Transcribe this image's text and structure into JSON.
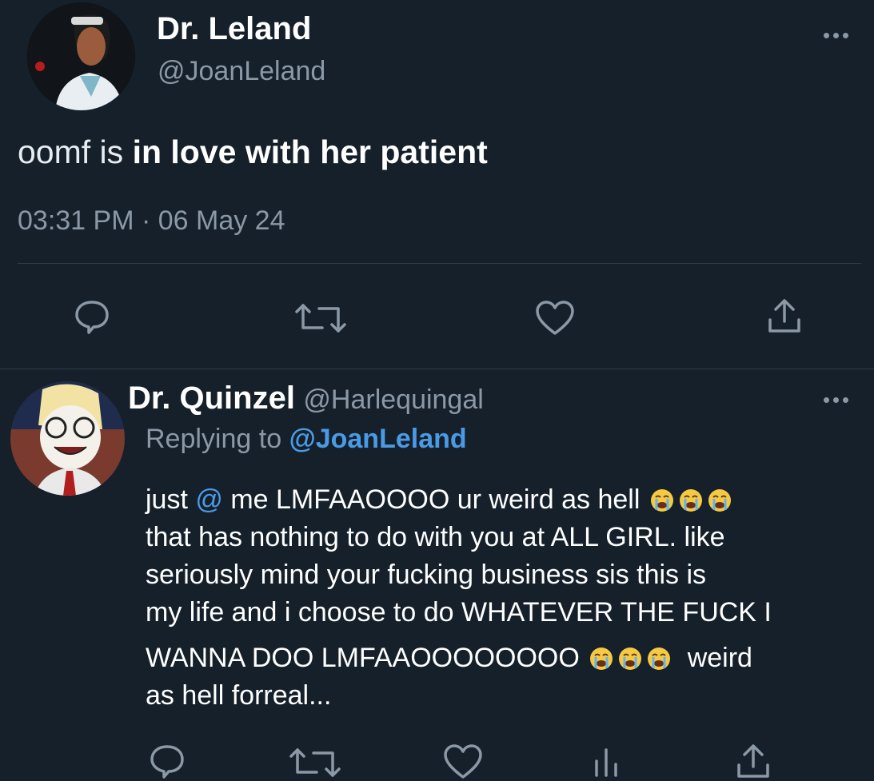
{
  "tweet": {
    "author_name": "Dr. Leland",
    "author_handle": "@JoanLeland",
    "text_prefix": "oomf is",
    "text_rest": "in love with her patient",
    "timestamp": "03:31 PM · 06 May 24"
  },
  "reply": {
    "author_name": "Dr. Quinzel",
    "author_handle": "@Harlequingal",
    "replying_label": "Replying to",
    "replying_handle": "@JoanLeland",
    "line1_a": "just",
    "line1_at": "@",
    "line1_b": "me LMFAAOOOO ur weird as hell",
    "line2": "that has nothing to do with you at ALL GIRL. like",
    "line3": "seriously mind your fucking business sis this is",
    "line4": "my life and i choose to do WHATEVER THE FUCK I",
    "line5_a": "WANNA DOO LMFAAOOOOOOOO",
    "line5_b": "weird",
    "line6": "as hell forreal..."
  },
  "icons": {
    "tweet_actions": [
      "reply-icon",
      "retweet-icon",
      "like-icon",
      "share-icon"
    ],
    "reply_actions": [
      "reply-icon",
      "retweet-icon",
      "like-icon",
      "analytics-icon",
      "share-icon"
    ],
    "emoji": "loudly-crying-face"
  },
  "colors": {
    "background": "#15202b",
    "text": "#ffffff",
    "muted": "#8b98a5",
    "link": "#4a9ae5"
  }
}
